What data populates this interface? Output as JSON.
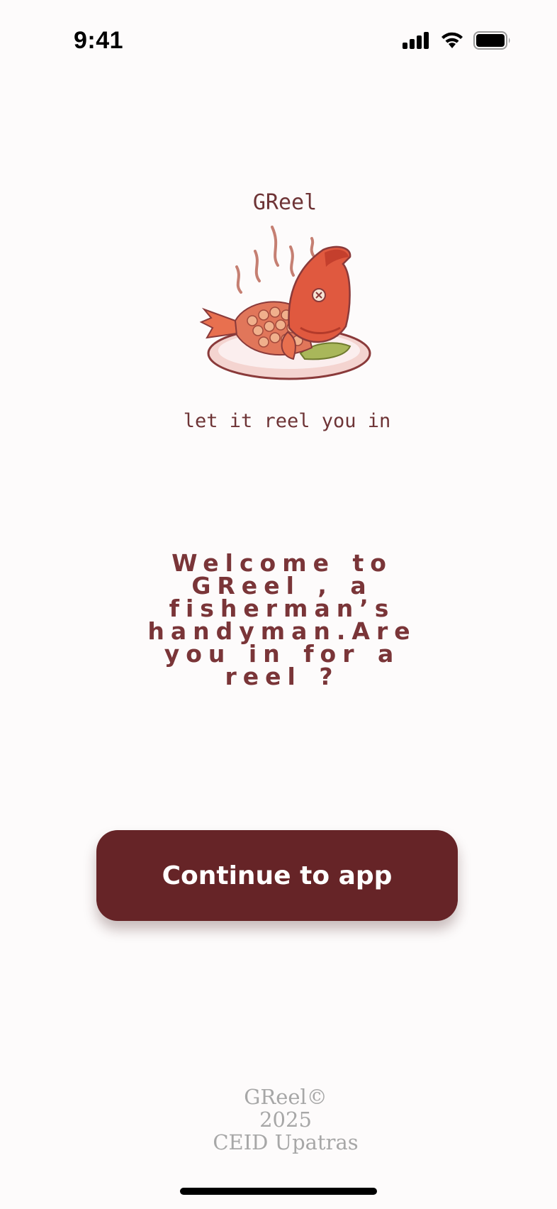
{
  "status_bar": {
    "time": "9:41",
    "icons": [
      "cellular-signal-icon",
      "wifi-icon",
      "battery-icon"
    ]
  },
  "logo": {
    "title": "GReel",
    "image": "steaming-fish-on-plate-icon",
    "tagline": "let it reel you in"
  },
  "welcome": {
    "message": "Welcome to GReel , a fisherman’s handyman.Are you in for a reel ?"
  },
  "actions": {
    "continue_label": "Continue to app"
  },
  "footer": {
    "brand": "GReel©",
    "year": "2025",
    "org": "CEID Upatras"
  },
  "colors": {
    "background": "#fdfbfb",
    "brand_maroon": "#662427",
    "text_maroon": "#7a3538",
    "footer_gray": "#a7a7a7"
  }
}
